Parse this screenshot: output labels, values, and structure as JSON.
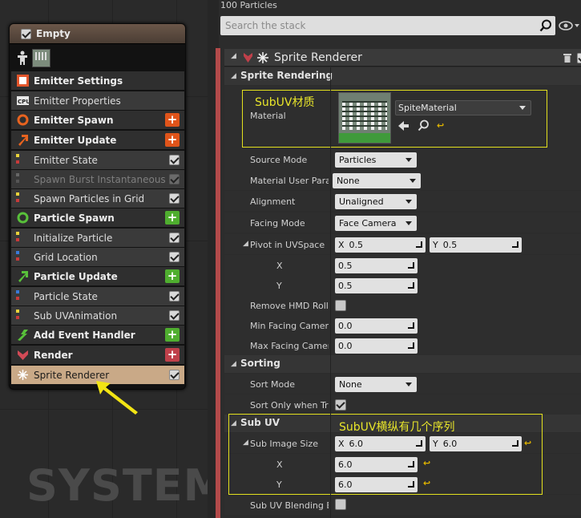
{
  "graph": {
    "system_label": "SYSTEM",
    "emitter": {
      "title": "Empty",
      "rows": [
        {
          "label": "Emitter Settings",
          "kind": "section",
          "icon": "emitter-settings-icon"
        },
        {
          "label": "Emitter Properties",
          "kind": "item",
          "icon": "cpu-icon"
        },
        {
          "label": "Emitter Spawn",
          "kind": "section",
          "icon": "emitter-spawn-icon",
          "add_color": "#e0541a"
        },
        {
          "label": "Emitter Update",
          "kind": "section",
          "icon": "emitter-update-icon",
          "add_color": "#e0541a"
        },
        {
          "label": "Emitter State",
          "kind": "item",
          "enabled": true
        },
        {
          "label": "Spawn Burst Instantaneous",
          "kind": "item",
          "enabled": false
        },
        {
          "label": "Spawn Particles in Grid",
          "kind": "item",
          "enabled": true
        },
        {
          "label": "Particle Spawn",
          "kind": "section",
          "icon": "particle-spawn-icon",
          "add_color": "#4fae2f"
        },
        {
          "label": "Initialize Particle",
          "kind": "item",
          "enabled": true
        },
        {
          "label": "Grid Location",
          "kind": "item",
          "enabled": true
        },
        {
          "label": "Particle Update",
          "kind": "section",
          "icon": "particle-update-icon",
          "add_color": "#4fae2f"
        },
        {
          "label": "Particle State",
          "kind": "item",
          "enabled": true
        },
        {
          "label": "Sub UVAnimation",
          "kind": "item",
          "enabled": true
        },
        {
          "label": "Add Event Handler",
          "kind": "section",
          "icon": "event-handler-icon",
          "add_color": "#4fae2f"
        },
        {
          "label": "Render",
          "kind": "section",
          "icon": "render-icon",
          "add_color": "#c0404a"
        },
        {
          "label": "Sprite Renderer",
          "kind": "selected",
          "enabled": true
        }
      ]
    }
  },
  "panel": {
    "particles_count": "100 Particles",
    "search_placeholder": "Search the stack",
    "module_title": "Sprite Renderer",
    "categories": {
      "sprite_rendering": "Sprite Rendering",
      "sorting": "Sorting",
      "sub_uv": "Sub UV"
    },
    "material": {
      "label": "Material",
      "value": "SpiteMaterial"
    },
    "source_mode": {
      "label": "Source Mode",
      "value": "Particles"
    },
    "material_user_param": {
      "label": "Material User Para",
      "value": "None"
    },
    "alignment": {
      "label": "Alignment",
      "value": "Unaligned"
    },
    "facing_mode": {
      "label": "Facing Mode",
      "value": "Face Camera"
    },
    "pivot": {
      "label": "Pivot in UVSpace",
      "x_axis": "X",
      "y_axis": "Y",
      "x": "0.5",
      "y": "0.5",
      "x_label": "X",
      "y_label": "Y"
    },
    "remove_hmd_roll": {
      "label": "Remove HMD Roll",
      "checked": false
    },
    "min_facing": {
      "label": "Min Facing Camera",
      "value": "0.0"
    },
    "max_facing": {
      "label": "Max Facing Camer",
      "value": "0.0"
    },
    "sort_mode": {
      "label": "Sort Mode",
      "value": "None"
    },
    "sort_only_when_translucent": {
      "label": "Sort Only when Tra",
      "checked": true
    },
    "sub_image_size": {
      "label": "Sub Image Size",
      "x_axis": "X",
      "y_axis": "Y",
      "x": "6.0",
      "y": "6.0",
      "x_label": "X",
      "y_label": "Y"
    },
    "sub_uv_blending": {
      "label": "Sub UV Blending Er",
      "checked": false
    }
  },
  "annotations": {
    "material_note": "SubUV材质",
    "subuv_note": "SubUV横纵有几个序列",
    "color": "#e8e52a"
  }
}
